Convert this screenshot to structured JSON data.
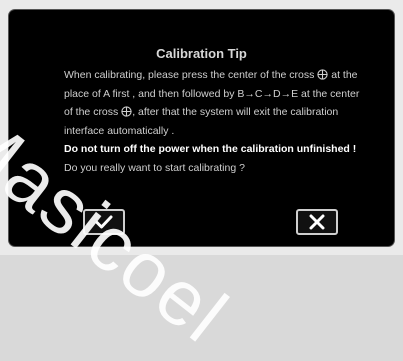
{
  "dialog": {
    "title": "Calibration Tip",
    "line1_a": "When calibrating, please press the center of the cross",
    "line1_b": "at the",
    "line2_a": "place of A first , and then followed by B",
    "line2_c": "C",
    "line2_d": "D",
    "line2_e": "E at the center",
    "line3_a": "of the cross",
    "line3_b": ", after that the system will exit the calibration",
    "line4": "interface automatically .",
    "warning": "Do not turn off the power when the calibration unfinished !",
    "question": "Do you really want to start calibrating ?",
    "arrow": "→"
  },
  "buttons": {
    "ok_icon": "checkmark-icon",
    "cancel_icon": "x-icon"
  },
  "watermark": "Masicoel"
}
